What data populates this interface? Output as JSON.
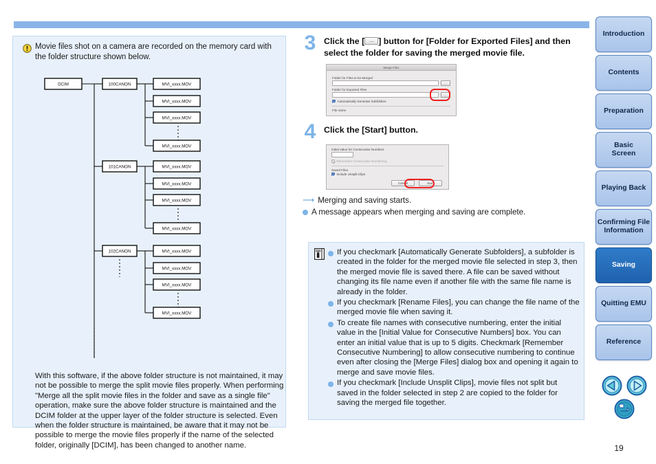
{
  "page": {
    "number": "19"
  },
  "left": {
    "caution": "Movie files shot on a camera are recorded on the memory card with the folder structure shown below.",
    "tree": {
      "root": "DCIM",
      "folders": [
        {
          "name": "100CANON",
          "files": [
            "MVI_xxxx.MOV",
            "MVI_xxxx.MOV",
            "MVI_xxxx.MOV",
            "MVI_xxxx.MOV"
          ]
        },
        {
          "name": "101CANON",
          "files": [
            "MVI_xxxx.MOV",
            "MVI_xxxx.MOV",
            "MVI_xxxx.MOV",
            "MVI_xxxx.MOV"
          ]
        },
        {
          "name": "102CANON",
          "files": [
            "MVI_xxxx.MOV",
            "MVI_xxxx.MOV",
            "MVI_xxxx.MOV",
            "MVI_xxxx.MOV"
          ]
        }
      ]
    },
    "paragraph": "With this software, if the above folder structure is not maintained, it may not be possible to merge the split movie files properly. When performing \"Merge all the split movie files in the folder and save as a single file\" operation, make sure the above folder structure is maintained and the DCIM folder at the upper layer of the folder structure is selected. Even when the folder structure is maintained, be aware that it may not be possible to merge the movie files properly if the name of the selected folder, originally [DCIM], has been changed to another name."
  },
  "right": {
    "step3": {
      "number": "3",
      "text_before": "Click the [",
      "text_after": "] button for [Folder for Exported Files] and then select the folder for saving the merged movie file."
    },
    "dialog1": {
      "title": "Merge Files",
      "label_merged_source": "Folder for Files to be Merged",
      "source_value": "",
      "browse_label": "...",
      "label_export": "Folder for Exported Files",
      "export_value": "",
      "checkbox_subfolders": "Automatically Generate Subfolders",
      "label_filename": "File name"
    },
    "step4": {
      "number": "4",
      "text": "Click the [Start] button."
    },
    "dialog2": {
      "label_initial_value": "Initial Value for Consecutive Numbers",
      "initial_value": "",
      "checkbox_remember": "Remember Consecutive Numbering",
      "label_saved_files": "Saved Files",
      "checkbox_unsplit": "Include Unsplit Clips",
      "cancel_label": "Cancel",
      "start_label": "Start"
    },
    "results": [
      {
        "marker": "arrow",
        "text": "Merging and saving starts."
      },
      {
        "marker": "dot",
        "text": "A message appears when merging and saving are complete."
      }
    ],
    "notes": [
      "If you checkmark [Automatically Generate Subfolders], a subfolder is created in the folder for the merged movie file selected in step 3, then the merged movie file is saved there. A file can be saved without changing its file name even if another file with the same file name is already in the folder.",
      "If you checkmark [Rename Files], you can change the file name of the merged movie file when saving it.",
      "To create file names with consecutive numbering, enter the initial value in the [Initial Value for Consecutive Numbers] box. You can enter an initial value that is up to 5 digits. Checkmark [Remember Consecutive Numbering] to allow consecutive numbering to continue even after closing the [Merge Files] dialog box and opening it again to merge and save movie files.",
      "If you checkmark [Include Unsplit Clips], movie files not split but saved in the folder selected in step 2 are copied to the folder for saving the merged file together."
    ]
  },
  "sidebar": {
    "tabs": [
      {
        "label": "Introduction",
        "active": false
      },
      {
        "label": "Contents",
        "active": false
      },
      {
        "label": "Preparation",
        "active": false
      },
      {
        "label": "Basic\nScreen",
        "active": false
      },
      {
        "label": "Playing Back",
        "active": false
      },
      {
        "label": "Confirming File\nInformation",
        "active": false
      },
      {
        "label": "Saving",
        "active": true
      },
      {
        "label": "Quitting EMU",
        "active": false
      },
      {
        "label": "Reference",
        "active": false
      }
    ],
    "nav": {
      "prev": "previous-page",
      "next": "next-page",
      "back": "return-to-index"
    }
  },
  "colors": {
    "accent": "#7db4e8",
    "panel_bg": "#e8f1fb",
    "tab_active": "#2f7bc8",
    "highlight_ring": "#ee2222"
  }
}
